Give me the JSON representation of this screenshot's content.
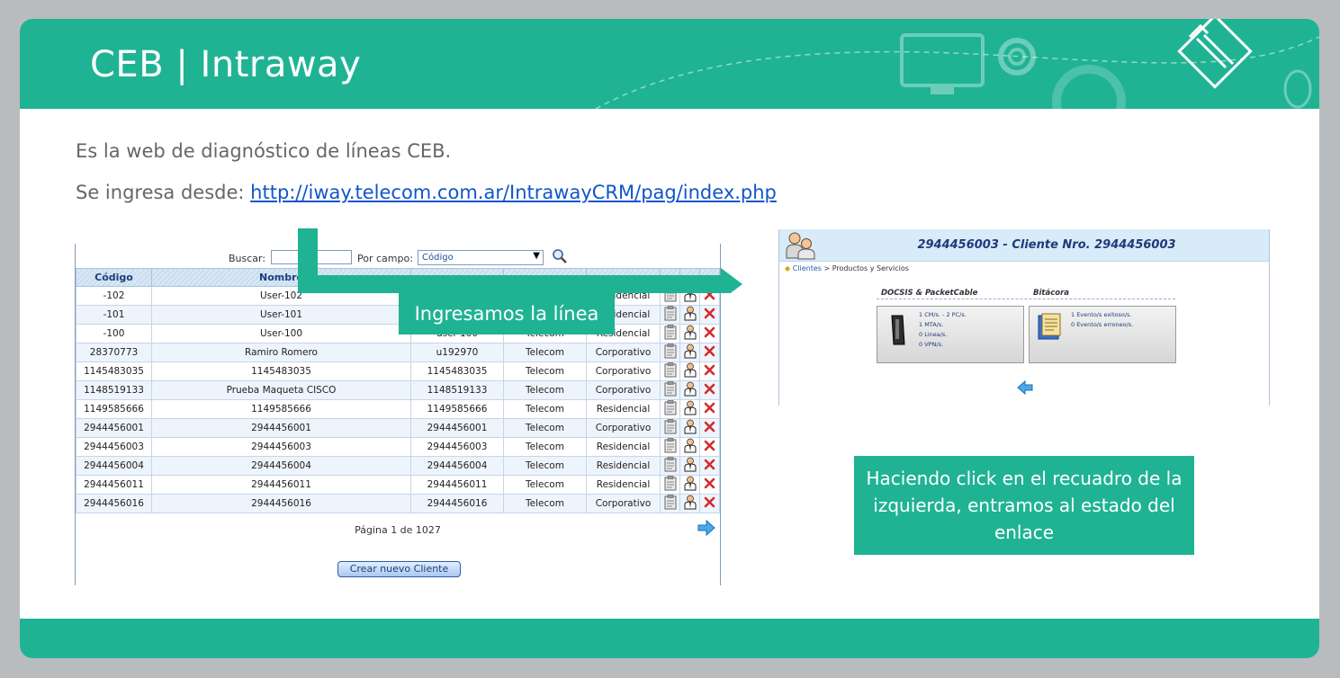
{
  "slide": {
    "title": "CEB | Intraway",
    "intro_line1": "Es la web de diagnóstico de líneas CEB.",
    "intro_line2_prefix": "Se ingresa desde: ",
    "intro_link": "http://iway.telecom.com.ar/IntrawayCRM/pag/index.php",
    "callout_left": "Ingresamos la línea",
    "callout_right": "Haciendo click en el recuadro de la izquierda, entramos al estado del enlace"
  },
  "colors": {
    "accent": "#1fb394",
    "link": "#1155cc",
    "table_header": "#1b3f7a"
  },
  "client_list": {
    "search_label": "Buscar:",
    "field_label": "Por campo:",
    "field_value": "Código",
    "columns": [
      "Código",
      "Nombre",
      "",
      "",
      ""
    ],
    "rows": [
      [
        "-102",
        "User-102",
        "",
        "",
        "Residencial"
      ],
      [
        "-101",
        "User-101",
        "",
        "",
        "Residencial"
      ],
      [
        "-100",
        "User-100",
        "user-100",
        "Telecom",
        "Residencial"
      ],
      [
        "28370773",
        "Ramiro Romero",
        "u192970",
        "Telecom",
        "Corporativo"
      ],
      [
        "1145483035",
        "1145483035",
        "1145483035",
        "Telecom",
        "Corporativo"
      ],
      [
        "1148519133",
        "Prueba Maqueta CISCO",
        "1148519133",
        "Telecom",
        "Corporativo"
      ],
      [
        "1149585666",
        "1149585666",
        "1149585666",
        "Telecom",
        "Residencial"
      ],
      [
        "2944456001",
        "2944456001",
        "2944456001",
        "Telecom",
        "Corporativo"
      ],
      [
        "2944456003",
        "2944456003",
        "2944456003",
        "Telecom",
        "Residencial"
      ],
      [
        "2944456004",
        "2944456004",
        "2944456004",
        "Telecom",
        "Residencial"
      ],
      [
        "2944456011",
        "2944456011",
        "2944456011",
        "Telecom",
        "Residencial"
      ],
      [
        "2944456016",
        "2944456016",
        "2944456016",
        "Telecom",
        "Corporativo"
      ]
    ],
    "row_icons": [
      "clipboard-icon",
      "user-icon",
      "delete-icon"
    ],
    "pagination": "Página 1 de 1027",
    "create_button": "Crear nuevo Cliente"
  },
  "client_detail": {
    "title": "2944456003 - Cliente Nro. 2944456003",
    "breadcrumb_link": "Clientes",
    "breadcrumb_rest": " > Productos y Servicios",
    "section_left": "DOCSIS & PacketCable",
    "section_right": "Bitácora",
    "docsis_lines": [
      "1 CM/s. - 2 PC/s.",
      "1 MTA/s.",
      "0 Linea/s.",
      "0 VPN/s."
    ],
    "bitacora_lines": [
      "1 Evento/s exitoso/s.",
      "0 Evento/s erroneo/s."
    ]
  }
}
